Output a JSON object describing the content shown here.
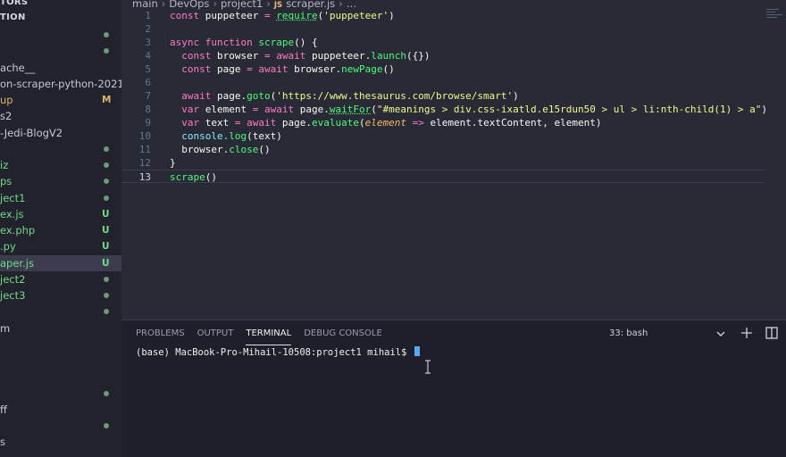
{
  "sidebar": {
    "headers": [
      "TORS",
      "TION"
    ],
    "items": [
      {
        "label": "",
        "badge": "",
        "dot": true
      },
      {
        "label": "",
        "badge": "",
        "dot": true
      },
      {
        "label": "ache__",
        "badge": "",
        "dot": false
      },
      {
        "label": "on-scraper-python-2021",
        "badge": "",
        "dot": false
      },
      {
        "label": "up",
        "badge": "M",
        "dot": false
      },
      {
        "label": "s2",
        "badge": "",
        "dot": false
      },
      {
        "label": "-Jedi-BlogV2",
        "badge": "",
        "dot": false
      },
      {
        "label": "",
        "badge": "",
        "dot": true
      },
      {
        "label": "iz",
        "badge": "",
        "dot": true
      },
      {
        "label": "ps",
        "badge": "",
        "dot": true
      },
      {
        "label": "ject1",
        "badge": "",
        "dot": true
      },
      {
        "label": "ex.js",
        "badge": "U",
        "dot": false
      },
      {
        "label": "ex.php",
        "badge": "U",
        "dot": false
      },
      {
        "label": ".py",
        "badge": "U",
        "dot": false
      },
      {
        "label": "aper.js",
        "badge": "U",
        "dot": false,
        "active": true
      },
      {
        "label": "ject2",
        "badge": "",
        "dot": true
      },
      {
        "label": "ject3",
        "badge": "",
        "dot": true
      },
      {
        "label": "",
        "badge": "",
        "dot": true
      },
      {
        "label": "m",
        "badge": "",
        "dot": false
      },
      {
        "label": "",
        "badge": "",
        "dot": false
      },
      {
        "label": "",
        "badge": "",
        "dot": false
      },
      {
        "label": "",
        "badge": "",
        "dot": false
      },
      {
        "label": "",
        "badge": "",
        "dot": true
      },
      {
        "label": "ff",
        "badge": "",
        "dot": false
      },
      {
        "label": "",
        "badge": "",
        "dot": true
      },
      {
        "label": "s",
        "badge": "",
        "dot": false
      }
    ]
  },
  "breadcrumb": [
    "main",
    "DevOps",
    "project1",
    "scraper.js",
    "…"
  ],
  "breadcrumb_file_icon": "JS",
  "code_lines": [
    [
      [
        "const ",
        "k"
      ],
      [
        "puppeteer ",
        "v"
      ],
      [
        "= ",
        "k"
      ],
      [
        "require",
        "f"
      ],
      [
        "(",
        "p"
      ],
      [
        "'puppeteer'",
        "s"
      ],
      [
        ")",
        "p"
      ]
    ],
    [],
    [
      [
        "async ",
        "k"
      ],
      [
        "function ",
        "k"
      ],
      [
        "scrape",
        "f"
      ],
      [
        "() {",
        "p"
      ]
    ],
    [
      [
        "  const ",
        "k"
      ],
      [
        "browser ",
        "v"
      ],
      [
        "= ",
        "k"
      ],
      [
        "await ",
        "k"
      ],
      [
        "puppeteer.",
        "v"
      ],
      [
        "launch",
        "f"
      ],
      [
        "({})",
        "p"
      ]
    ],
    [
      [
        "  const ",
        "k"
      ],
      [
        "page ",
        "v"
      ],
      [
        "= ",
        "k"
      ],
      [
        "await ",
        "k"
      ],
      [
        "browser.",
        "v"
      ],
      [
        "newPage",
        "f"
      ],
      [
        "()",
        "p"
      ]
    ],
    [],
    [
      [
        "  await ",
        "k"
      ],
      [
        "page.",
        "v"
      ],
      [
        "goto",
        "f"
      ],
      [
        "(",
        "p"
      ],
      [
        "'https://www.thesaurus.com/browse/smart'",
        "s"
      ],
      [
        ")",
        "p"
      ]
    ],
    [
      [
        "  var ",
        "k"
      ],
      [
        "element ",
        "v"
      ],
      [
        "= ",
        "k"
      ],
      [
        "await ",
        "k"
      ],
      [
        "page.",
        "v"
      ],
      [
        "waitFor",
        "f"
      ],
      [
        "(",
        "p"
      ],
      [
        "\"#meanings > div.css-ixatld.e15rdun50 > ul > li:nth-child(1) > a\"",
        "s"
      ],
      [
        ")",
        "p"
      ]
    ],
    [
      [
        "  var ",
        "k"
      ],
      [
        "text ",
        "v"
      ],
      [
        "= ",
        "k"
      ],
      [
        "await ",
        "k"
      ],
      [
        "page.",
        "v"
      ],
      [
        "evaluate",
        "f"
      ],
      [
        "(",
        "p"
      ],
      [
        "element ",
        "prm"
      ],
      [
        "=> ",
        "k"
      ],
      [
        "element.textContent, element",
        "v"
      ],
      [
        ")",
        "p"
      ]
    ],
    [
      [
        "  console.",
        "c"
      ],
      [
        "log",
        "f"
      ],
      [
        "(text)",
        "p"
      ]
    ],
    [
      [
        "  browser.",
        "v"
      ],
      [
        "close",
        "f"
      ],
      [
        "()",
        "p"
      ]
    ],
    [
      [
        "}",
        "p"
      ]
    ],
    [
      [
        "scrape",
        "f"
      ],
      [
        "()",
        "p"
      ]
    ]
  ],
  "current_line": 13,
  "panel": {
    "tabs": [
      {
        "label": "PROBLEMS",
        "active": false
      },
      {
        "label": "OUTPUT",
        "active": false
      },
      {
        "label": "TERMINAL",
        "active": true
      },
      {
        "label": "DEBUG CONSOLE",
        "active": false
      }
    ],
    "terminal_select": "33: bash",
    "terminal_prompt": "(base) MacBook-Pro-Mihail-10508:project1 mihail$ "
  },
  "icons": {
    "dropdown": "chevron-down-icon",
    "new_terminal": "plus-icon",
    "split_terminal": "split-icon",
    "cursor": "text-cursor-icon"
  },
  "colors": {
    "added": "#73d98a",
    "modified": "#d5b66a",
    "untracked": "#73d98a",
    "dot": "#6b9a7a",
    "accent": "#5aa7f5"
  }
}
